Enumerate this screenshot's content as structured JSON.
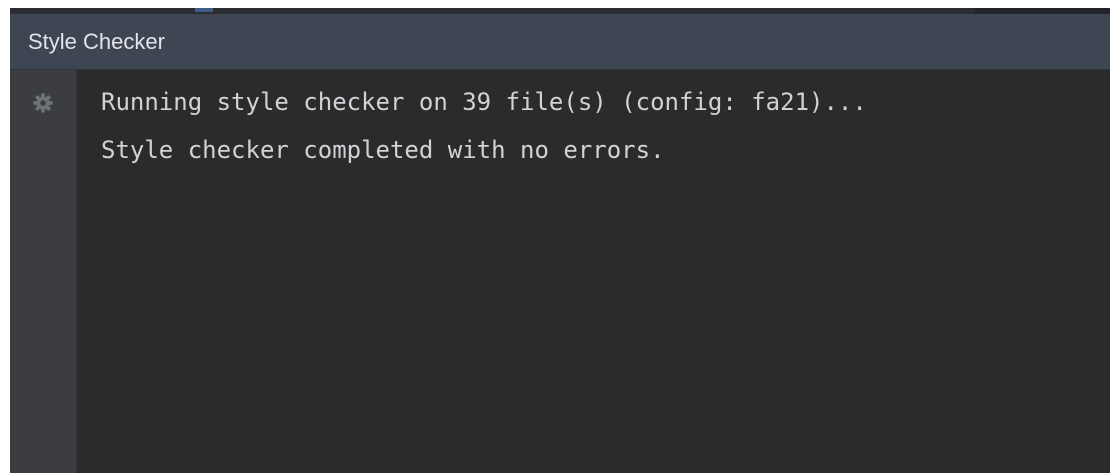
{
  "panel": {
    "title": "Style Checker"
  },
  "gutter": {
    "icon": "gear-icon"
  },
  "console": {
    "lines": [
      "Running style checker on 39 file(s) (config: fa21)...",
      "Style checker completed with no errors."
    ]
  },
  "colors": {
    "title_bar": "#3e4654",
    "console_background": "#2b2b2b",
    "gutter_background": "#3b3d40",
    "text": "#cfd2d6"
  }
}
